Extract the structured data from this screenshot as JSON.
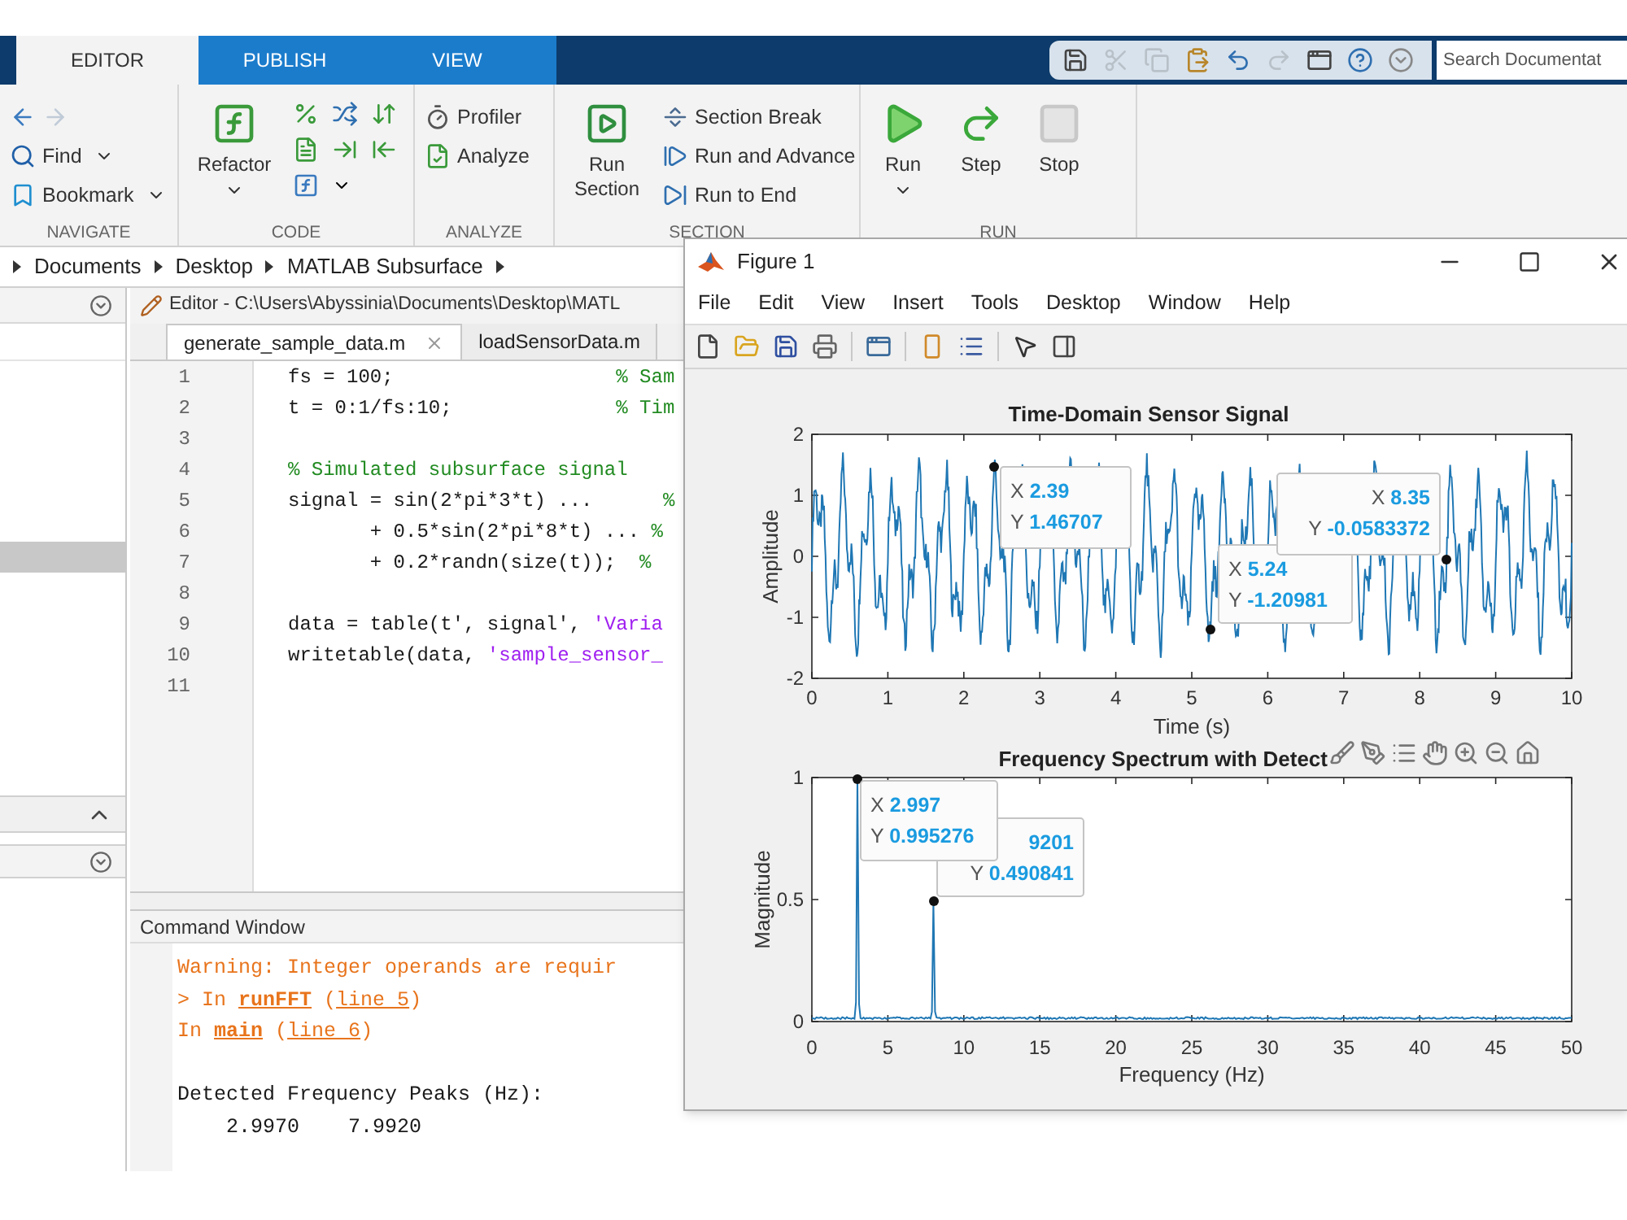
{
  "tabs": [
    {
      "label": "EDITOR",
      "selected": true
    },
    {
      "label": "PUBLISH",
      "selected": false
    },
    {
      "label": "VIEW",
      "selected": false
    }
  ],
  "search": {
    "placeholder": "Search Documentat"
  },
  "ribbon": [
    {
      "label": "NAVIGATE",
      "kind": "navigate",
      "items": [
        {
          "label": "Find",
          "kind": "small",
          "menu": true
        },
        {
          "label": "Bookmark",
          "kind": "small",
          "menu": true
        }
      ]
    },
    {
      "label": "CODE",
      "kind": "code",
      "items": [
        {
          "label": "Refactor",
          "kind": "large",
          "menu": true
        }
      ]
    },
    {
      "label": "ANALYZE",
      "kind": "analyze",
      "items": [
        {
          "label": "Profiler",
          "kind": "small",
          "menu": false
        },
        {
          "label": "Analyze",
          "kind": "small",
          "menu": false
        }
      ]
    },
    {
      "label": "SECTION",
      "kind": "section",
      "items": [
        {
          "label": "Run Section",
          "kind": "large",
          "menu": false
        },
        {
          "label": "Section Break",
          "kind": "small",
          "menu": false
        },
        {
          "label": "Run and Advance",
          "kind": "small",
          "menu": false
        },
        {
          "label": "Run to End",
          "kind": "small",
          "menu": false
        }
      ]
    },
    {
      "label": "RUN",
      "kind": "run",
      "items": [
        {
          "label": "Run",
          "kind": "large",
          "menu": true,
          "disabled": false
        },
        {
          "label": "Step",
          "kind": "large",
          "menu": false,
          "disabled": false
        },
        {
          "label": "Stop",
          "kind": "large",
          "menu": false,
          "disabled": true
        }
      ]
    }
  ],
  "address_bar": [
    "Documents",
    "Desktop",
    "MATLAB Subsurface"
  ],
  "editor": {
    "title": "Editor - C:\\Users\\Abyssinia\\Documents\\Desktop\\MATL",
    "tabs": [
      {
        "label": "generate_sample_data.m",
        "selected": true
      },
      {
        "label": "loadSensorData.m",
        "selected": false
      }
    ],
    "lines": [
      {
        "number": "1",
        "segments": [
          {
            "kind": "code",
            "text": "fs = 100;                   "
          },
          {
            "kind": "comment",
            "text": "% Sam"
          }
        ]
      },
      {
        "number": "2",
        "segments": [
          {
            "kind": "code",
            "text": "t = 0:1/fs:10;              "
          },
          {
            "kind": "comment",
            "text": "% Tim"
          }
        ]
      },
      {
        "number": "3"
      },
      {
        "number": "4",
        "segments": [
          {
            "kind": "comment",
            "text": "% Simulated subsurface signal"
          }
        ]
      },
      {
        "number": "5",
        "segments": [
          {
            "kind": "code",
            "text": "signal = sin(2*pi*3*t) ...      "
          },
          {
            "kind": "comment",
            "text": "%"
          }
        ]
      },
      {
        "number": "6",
        "segments": [
          {
            "kind": "code",
            "text": "       + 0.5*sin(2*pi*8*t) ... "
          },
          {
            "kind": "comment",
            "text": "%"
          }
        ]
      },
      {
        "number": "7",
        "segments": [
          {
            "kind": "code",
            "text": "       + 0.2*randn(size(t));  "
          },
          {
            "kind": "comment",
            "text": "%"
          }
        ]
      },
      {
        "number": "8"
      },
      {
        "number": "9",
        "segments": [
          {
            "kind": "code",
            "text": "data = table(t', signal', "
          },
          {
            "kind": "string",
            "text": "'Varia"
          }
        ]
      },
      {
        "number": "10",
        "segments": [
          {
            "kind": "code",
            "text": "writetable(data, "
          },
          {
            "kind": "string",
            "text": "'sample_sensor_"
          }
        ]
      },
      {
        "number": "11"
      }
    ]
  },
  "command_window": {
    "title": "Command Window",
    "lines": [
      {
        "kind": "warning",
        "segments": [
          {
            "kind": "text",
            "text": "Warning: Integer operands are requir"
          }
        ]
      },
      {
        "kind": "warning",
        "segments": [
          {
            "kind": "text",
            "text": "> In "
          },
          {
            "kind": "function_link",
            "text": "runFFT"
          },
          {
            "kind": "text",
            "text": " ("
          },
          {
            "kind": "line_link",
            "text": "line 5"
          },
          {
            "kind": "text",
            "text": ")"
          }
        ]
      },
      {
        "kind": "warning",
        "segments": [
          {
            "kind": "text",
            "text": "In "
          },
          {
            "kind": "function_link",
            "text": "main"
          },
          {
            "kind": "text",
            "text": " ("
          },
          {
            "kind": "line_link",
            "text": "line 6"
          },
          {
            "kind": "text",
            "text": ")"
          }
        ]
      },
      {
        "kind": "blank"
      },
      {
        "kind": "output",
        "segments": [
          {
            "kind": "text",
            "text": "Detected Frequency Peaks (Hz):"
          }
        ]
      },
      {
        "kind": "output",
        "segments": [
          {
            "kind": "text",
            "text": "    2.9970    7.9920"
          }
        ]
      }
    ]
  },
  "figure": {
    "title": "Figure 1",
    "menu": [
      "File",
      "Edit",
      "View",
      "Insert",
      "Tools",
      "Desktop",
      "Window",
      "Help"
    ],
    "plots": [
      {
        "kind": "time_signal",
        "title": "Time-Domain Sensor Signal",
        "xlabel": "Time (s)",
        "ylabel": "Amplitude",
        "xticks": [
          "0",
          "1",
          "2",
          "3",
          "4",
          "5",
          "6",
          "7",
          "8",
          "9",
          "10"
        ],
        "yticks": [
          "2",
          "1",
          "0",
          "-1",
          "-2"
        ],
        "datatips": [
          {
            "rows": [
              {
                "label": "X",
                "value": "2.39"
              },
              {
                "label": "Y",
                "value": "1.46707"
              }
            ]
          },
          {
            "rows": [
              {
                "label": "X",
                "value": "8.35"
              },
              {
                "label": "Y",
                "value": "-0.0583372"
              }
            ]
          },
          {
            "rows": [
              {
                "label": "X",
                "value": "5.24"
              },
              {
                "label": "Y",
                "value": "-1.20981"
              }
            ]
          }
        ]
      },
      {
        "kind": "spectrum",
        "title": "Frequency Spectrum with Detect",
        "xlabel": "Frequency (Hz)",
        "ylabel": "Magnitude",
        "xticks": [
          "0",
          "5",
          "10",
          "15",
          "20",
          "25",
          "30",
          "35",
          "40",
          "45",
          "50"
        ],
        "yticks": [
          "1",
          "0.5",
          "0"
        ],
        "datatips": [
          {
            "rows": [
              {
                "label": "X",
                "value": "2.997"
              },
              {
                "label": "Y",
                "value": "0.995276"
              }
            ]
          },
          {
            "rows": [
              {
                "value": "9201"
              },
              {
                "label": "Y",
                "value": "0.490841"
              }
            ]
          }
        ]
      }
    ]
  }
}
